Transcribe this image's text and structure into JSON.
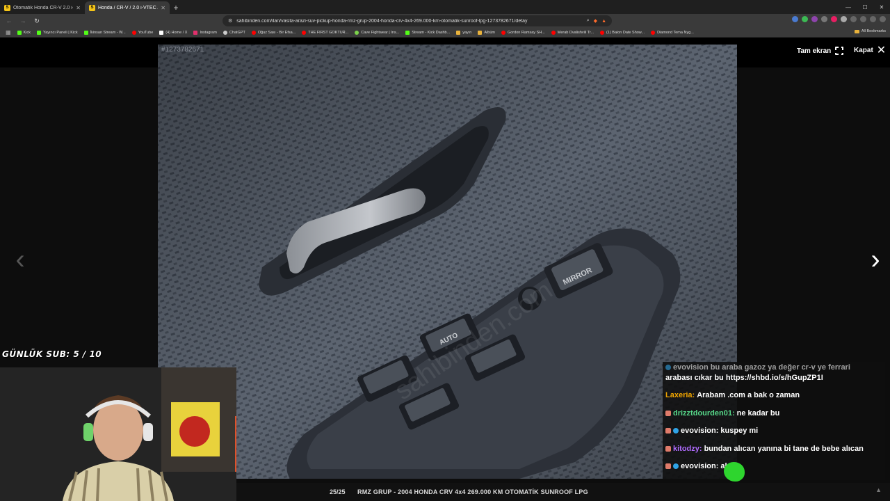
{
  "browser": {
    "tabs": [
      {
        "title": "Otomatik Honda CR-V 2.0 i-VTEC Fiy",
        "active": false
      },
      {
        "title": "Honda / CR-V / 2.0 i-VTEC / ES /",
        "active": true
      }
    ],
    "url": "sahibinden.com/ilan/vasita-arazi-suv-pickup-honda-rmz-grup-2004-honda-crv-4x4-269.000-km-otomatik-sunroof-lpg-1273782671/detay",
    "bookmarks": [
      {
        "label": "Kick",
        "color": "#53fc18"
      },
      {
        "label": "Yayıncı Paneli | Kick",
        "color": "#53fc18"
      },
      {
        "label": "İkinsan Stream - W...",
        "color": "#53fc18"
      },
      {
        "label": "YouTube",
        "color": "#ff0000"
      },
      {
        "label": "(4) Home / X",
        "color": "#ffffff"
      },
      {
        "label": "Instagram",
        "color": "#e1306c"
      },
      {
        "label": "ChatGPT",
        "color": "#cccccc"
      },
      {
        "label": "Oğuz Sası - Bir Efsa...",
        "color": "#ff0000"
      },
      {
        "label": "THE FIRST GOKTUR...",
        "color": "#ff0000"
      },
      {
        "label": "Cave Fightwear | Ins...",
        "color": "#7cd34b"
      },
      {
        "label": "Stream - Kick Dashb...",
        "color": "#53fc18"
      },
      {
        "label": "yayın",
        "color": "#e8b23c"
      },
      {
        "label": "Albüm",
        "color": "#e8b23c"
      },
      {
        "label": "Gordon Ramsay SH...",
        "color": "#ff0000"
      },
      {
        "label": "Merab Dvalishvili Tr...",
        "color": "#ff0000"
      },
      {
        "label": "(1) Balon Date Show...",
        "color": "#ff0000"
      },
      {
        "label": "Diamond Tema Nyg...",
        "color": "#ff0000"
      }
    ],
    "all_bookmarks": "All Bookmarks"
  },
  "gallery": {
    "ad_id": "#1273782671",
    "fullscreen_label": "Tam ekran",
    "close_label": "Kapat",
    "counter": "25/25",
    "caption": "RMZ GRUP - 2004 HONDA CRV 4x4 269.000 KM OTOMATİK SUNROOF LPG",
    "photo_labels": {
      "auto": "AUTO",
      "mirror": "MIRROR",
      "watermark": "sahibinden.com"
    }
  },
  "stream": {
    "sub_goal": "GÜNLÜK SUB: 5 / 10",
    "chat": [
      {
        "user": "evovision",
        "text": "bu araba gazoz ya değer cr-v ye ferrari",
        "user_color": "#ffffff",
        "partial": true
      },
      {
        "user": "",
        "text": "arabası cıkar bu https://shbd.io/s/hGupZP1I",
        "user_color": "#ffffff"
      },
      {
        "user": "Laxeria:",
        "text": "Arabam .com a bak o zaman",
        "user_color": "#f0a500"
      },
      {
        "user": "drizztdourden01:",
        "text": "ne kadar bu",
        "user_color": "#57d98a"
      },
      {
        "user": "evovision:",
        "text": "kuspey mi",
        "user_color": "#ffffff"
      },
      {
        "user": "kitodzy:",
        "text": "bundan alıcan yanına bi tane de bebe alıcan",
        "user_color": "#b06cff"
      },
      {
        "user": "evovision:",
        "text": "almış",
        "user_color": "#ffffff"
      }
    ]
  }
}
